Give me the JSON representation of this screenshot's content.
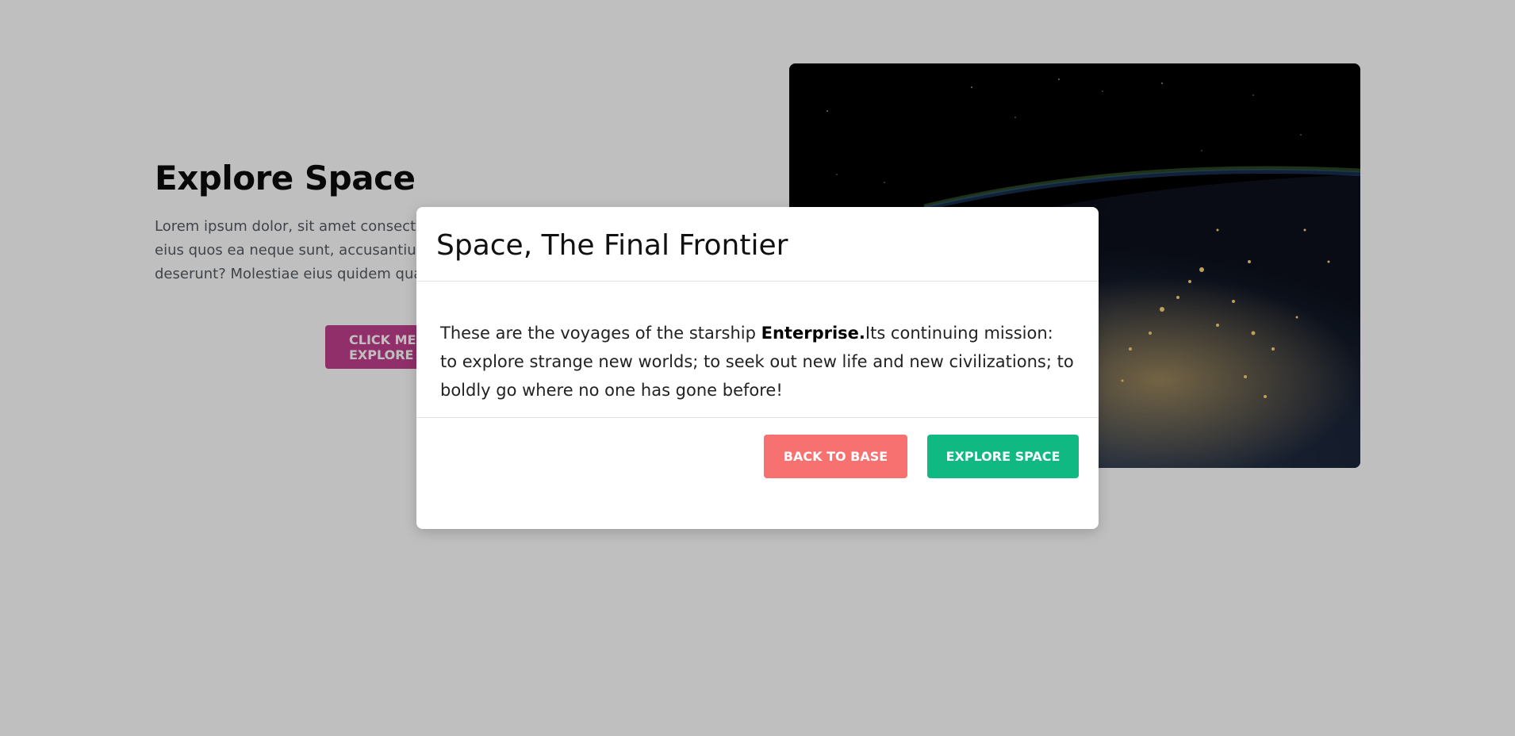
{
  "hero": {
    "title": "Explore Space",
    "body": "Lorem ipsum dolor, sit amet consectetur adipisicing elit. Quod, velit? Ut quis eius quos ea neque sunt, accusantium, totam aperiam labore corporis deserunt? Molestiae eius quidem quasi!",
    "button_label": "CLICK ME TO EXPLORE",
    "image_alt": "Earth at night from orbit"
  },
  "modal": {
    "title": "Space, The Final Frontier",
    "body_before": "These are the voyages of the starship ",
    "body_bold": "Enterprise.",
    "body_after": "Its continuing mission: to explore strange new worlds; to seek out new life and new civilizations; to boldly go where no one has gone before!",
    "back_button_label": "BACK TO BASE",
    "explore_button_label": "EXPLORE SPACE"
  },
  "colors": {
    "overlay": "#bfbfbf",
    "hero_button": "#c13f8c",
    "back_button": "#f87171",
    "explore_button": "#10b981"
  }
}
